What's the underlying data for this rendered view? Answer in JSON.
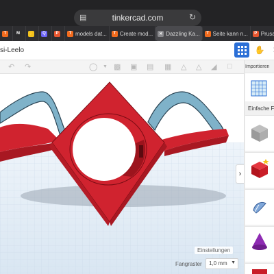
{
  "browser": {
    "url": "tinkercad.com",
    "tabs": [
      {
        "label": "",
        "favicon_color": "#f26b1d",
        "favicon": "T"
      },
      {
        "label": "",
        "favicon_color": "#2b2b2d",
        "favicon": "M"
      },
      {
        "label": "",
        "favicon_color": "#f2c21d",
        "favicon": "⚡"
      },
      {
        "label": "",
        "favicon_color": "#6b63f5",
        "favicon": "Q"
      },
      {
        "label": "",
        "favicon_color": "#e8562f",
        "favicon": "P"
      },
      {
        "label": "models dat...",
        "favicon_color": "#f26b1d",
        "favicon": "T"
      },
      {
        "label": "Create mod...",
        "favicon_color": "#f26b1d",
        "favicon": "T"
      },
      {
        "label": "Dazzling Ka...",
        "favicon_color": "#8a8a8e",
        "favicon": "✕",
        "active": true
      },
      {
        "label": "Seite kann n...",
        "favicon_color": "#f26b1d",
        "favicon": "T"
      },
      {
        "label": "Prusa Acco...",
        "favicon_color": "#e8562f",
        "favicon": "P"
      },
      {
        "label": "",
        "favicon_color": "#f26b1d",
        "favicon": "T"
      }
    ]
  },
  "app": {
    "design_title": "si-Leelo",
    "import_label": "Importieren",
    "panel_label": "Einfache Fo",
    "settings_label": "Einstellungen",
    "grid_label": "Fangraster",
    "grid_value": "1,0 mm",
    "accent": "#2b6fd6"
  },
  "scene": {
    "object_color": "#d0232f",
    "arch_color": "#7fb2c9",
    "grid_color": "#c8d7e6"
  },
  "shapes": [
    {
      "name": "striped-box-icon"
    },
    {
      "name": "red-box-icon"
    },
    {
      "name": "scribble-icon"
    },
    {
      "name": "cone-icon"
    }
  ]
}
